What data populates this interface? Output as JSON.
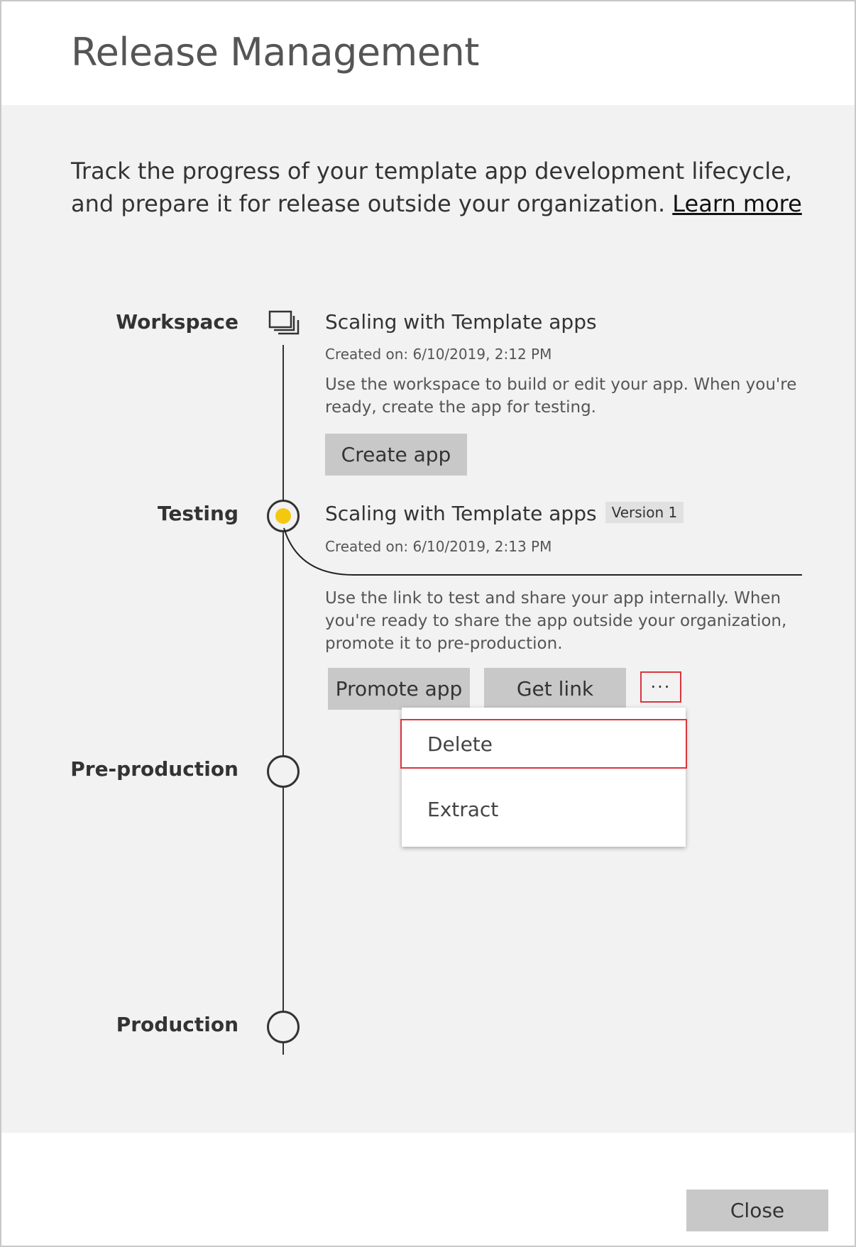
{
  "dialog": {
    "title": "Release Management",
    "intro_text": "Track the progress of your template app development lifecycle, and prepare it for release outside your organization. ",
    "learn_more": "Learn more",
    "close_label": "Close"
  },
  "stages": {
    "workspace": {
      "label": "Workspace",
      "app_name": "Scaling with Template apps",
      "created": "Created on: 6/10/2019, 2:12 PM",
      "description": "Use the workspace to build or edit your app. When you're ready, create the app for testing.",
      "button": "Create app"
    },
    "testing": {
      "label": "Testing",
      "app_name": "Scaling with Template apps",
      "version": "Version 1",
      "created": "Created on: 6/10/2019, 2:13 PM",
      "description": "Use the link to test and share your app internally. When you're ready to share the app outside your organization, promote it to pre-production.",
      "promote_button": "Promote app",
      "get_link_button": "Get link",
      "more_button": "···"
    },
    "preproduction": {
      "label": "Pre-production"
    },
    "production": {
      "label": "Production"
    }
  },
  "more_menu": {
    "items": [
      "Delete",
      "Extract"
    ]
  },
  "colors": {
    "accent_dot": "#f2c811",
    "highlight_border": "#d9363e",
    "content_bg": "#f2f2f2",
    "button_bg": "#c8c8c8"
  }
}
